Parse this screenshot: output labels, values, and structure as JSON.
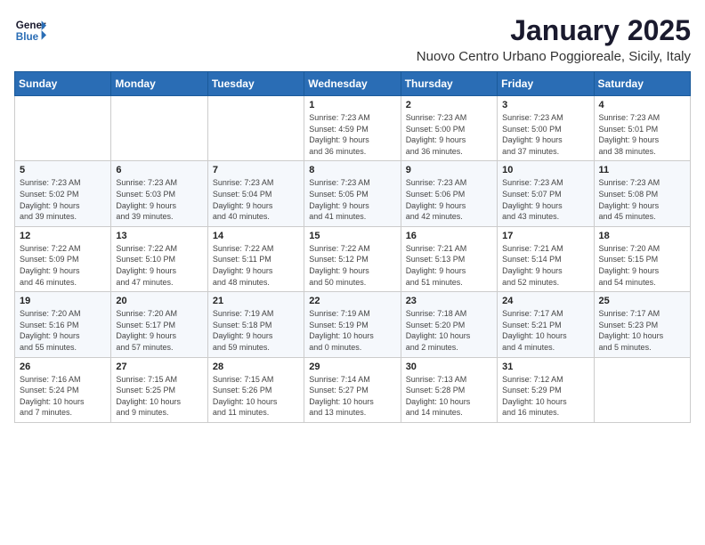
{
  "header": {
    "logo_line1": "General",
    "logo_line2": "Blue",
    "month": "January 2025",
    "location": "Nuovo Centro Urbano Poggioreale, Sicily, Italy"
  },
  "weekdays": [
    "Sunday",
    "Monday",
    "Tuesday",
    "Wednesday",
    "Thursday",
    "Friday",
    "Saturday"
  ],
  "weeks": [
    [
      {
        "day": "",
        "info": ""
      },
      {
        "day": "",
        "info": ""
      },
      {
        "day": "",
        "info": ""
      },
      {
        "day": "1",
        "info": "Sunrise: 7:23 AM\nSunset: 4:59 PM\nDaylight: 9 hours\nand 36 minutes."
      },
      {
        "day": "2",
        "info": "Sunrise: 7:23 AM\nSunset: 5:00 PM\nDaylight: 9 hours\nand 36 minutes."
      },
      {
        "day": "3",
        "info": "Sunrise: 7:23 AM\nSunset: 5:00 PM\nDaylight: 9 hours\nand 37 minutes."
      },
      {
        "day": "4",
        "info": "Sunrise: 7:23 AM\nSunset: 5:01 PM\nDaylight: 9 hours\nand 38 minutes."
      }
    ],
    [
      {
        "day": "5",
        "info": "Sunrise: 7:23 AM\nSunset: 5:02 PM\nDaylight: 9 hours\nand 39 minutes."
      },
      {
        "day": "6",
        "info": "Sunrise: 7:23 AM\nSunset: 5:03 PM\nDaylight: 9 hours\nand 39 minutes."
      },
      {
        "day": "7",
        "info": "Sunrise: 7:23 AM\nSunset: 5:04 PM\nDaylight: 9 hours\nand 40 minutes."
      },
      {
        "day": "8",
        "info": "Sunrise: 7:23 AM\nSunset: 5:05 PM\nDaylight: 9 hours\nand 41 minutes."
      },
      {
        "day": "9",
        "info": "Sunrise: 7:23 AM\nSunset: 5:06 PM\nDaylight: 9 hours\nand 42 minutes."
      },
      {
        "day": "10",
        "info": "Sunrise: 7:23 AM\nSunset: 5:07 PM\nDaylight: 9 hours\nand 43 minutes."
      },
      {
        "day": "11",
        "info": "Sunrise: 7:23 AM\nSunset: 5:08 PM\nDaylight: 9 hours\nand 45 minutes."
      }
    ],
    [
      {
        "day": "12",
        "info": "Sunrise: 7:22 AM\nSunset: 5:09 PM\nDaylight: 9 hours\nand 46 minutes."
      },
      {
        "day": "13",
        "info": "Sunrise: 7:22 AM\nSunset: 5:10 PM\nDaylight: 9 hours\nand 47 minutes."
      },
      {
        "day": "14",
        "info": "Sunrise: 7:22 AM\nSunset: 5:11 PM\nDaylight: 9 hours\nand 48 minutes."
      },
      {
        "day": "15",
        "info": "Sunrise: 7:22 AM\nSunset: 5:12 PM\nDaylight: 9 hours\nand 50 minutes."
      },
      {
        "day": "16",
        "info": "Sunrise: 7:21 AM\nSunset: 5:13 PM\nDaylight: 9 hours\nand 51 minutes."
      },
      {
        "day": "17",
        "info": "Sunrise: 7:21 AM\nSunset: 5:14 PM\nDaylight: 9 hours\nand 52 minutes."
      },
      {
        "day": "18",
        "info": "Sunrise: 7:20 AM\nSunset: 5:15 PM\nDaylight: 9 hours\nand 54 minutes."
      }
    ],
    [
      {
        "day": "19",
        "info": "Sunrise: 7:20 AM\nSunset: 5:16 PM\nDaylight: 9 hours\nand 55 minutes."
      },
      {
        "day": "20",
        "info": "Sunrise: 7:20 AM\nSunset: 5:17 PM\nDaylight: 9 hours\nand 57 minutes."
      },
      {
        "day": "21",
        "info": "Sunrise: 7:19 AM\nSunset: 5:18 PM\nDaylight: 9 hours\nand 59 minutes."
      },
      {
        "day": "22",
        "info": "Sunrise: 7:19 AM\nSunset: 5:19 PM\nDaylight: 10 hours\nand 0 minutes."
      },
      {
        "day": "23",
        "info": "Sunrise: 7:18 AM\nSunset: 5:20 PM\nDaylight: 10 hours\nand 2 minutes."
      },
      {
        "day": "24",
        "info": "Sunrise: 7:17 AM\nSunset: 5:21 PM\nDaylight: 10 hours\nand 4 minutes."
      },
      {
        "day": "25",
        "info": "Sunrise: 7:17 AM\nSunset: 5:23 PM\nDaylight: 10 hours\nand 5 minutes."
      }
    ],
    [
      {
        "day": "26",
        "info": "Sunrise: 7:16 AM\nSunset: 5:24 PM\nDaylight: 10 hours\nand 7 minutes."
      },
      {
        "day": "27",
        "info": "Sunrise: 7:15 AM\nSunset: 5:25 PM\nDaylight: 10 hours\nand 9 minutes."
      },
      {
        "day": "28",
        "info": "Sunrise: 7:15 AM\nSunset: 5:26 PM\nDaylight: 10 hours\nand 11 minutes."
      },
      {
        "day": "29",
        "info": "Sunrise: 7:14 AM\nSunset: 5:27 PM\nDaylight: 10 hours\nand 13 minutes."
      },
      {
        "day": "30",
        "info": "Sunrise: 7:13 AM\nSunset: 5:28 PM\nDaylight: 10 hours\nand 14 minutes."
      },
      {
        "day": "31",
        "info": "Sunrise: 7:12 AM\nSunset: 5:29 PM\nDaylight: 10 hours\nand 16 minutes."
      },
      {
        "day": "",
        "info": ""
      }
    ]
  ]
}
